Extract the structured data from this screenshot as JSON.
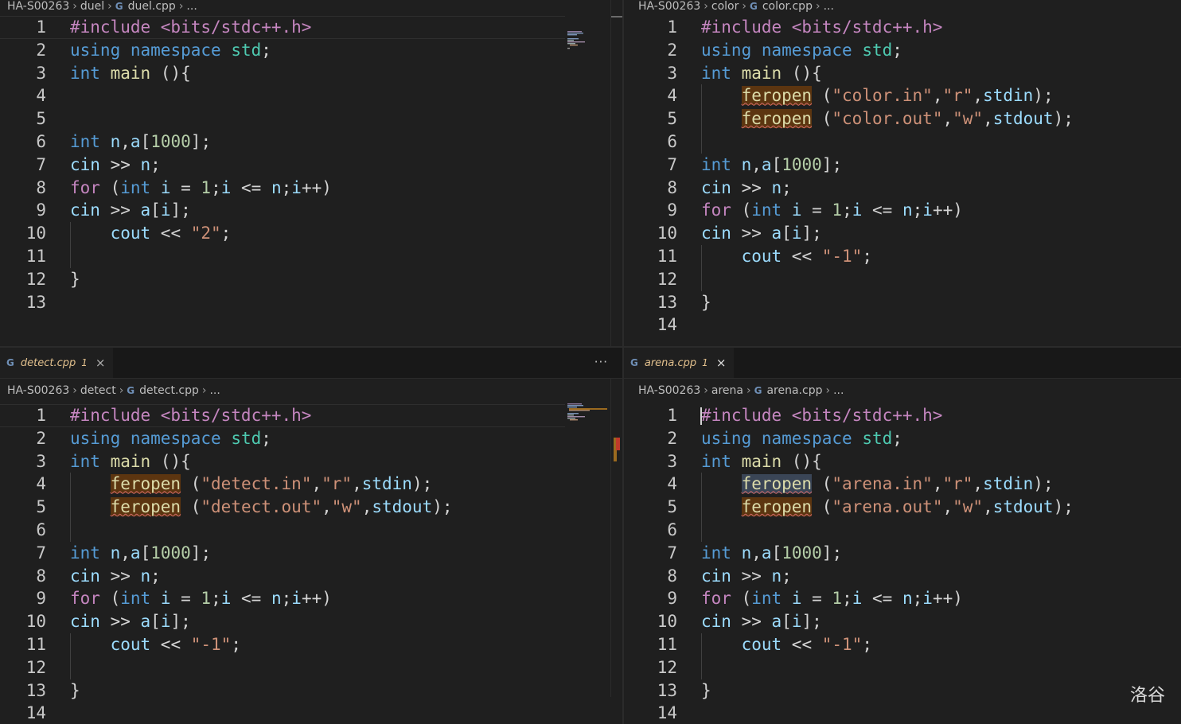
{
  "panes": {
    "tl": {
      "crumbs": {
        "root": "HA-S00263",
        "folder": "duel",
        "file": "duel.cpp",
        "more": "..."
      }
    },
    "tr": {
      "crumbs": {
        "root": "HA-S00263",
        "folder": "color",
        "file": "color.cpp",
        "more": "..."
      }
    },
    "bl": {
      "tab": {
        "icon": "C++",
        "name": "detect.cpp",
        "count": "1",
        "close": "×"
      },
      "more": "···",
      "crumbs": {
        "root": "HA-S00263",
        "folder": "detect",
        "file": "detect.cpp",
        "more": "..."
      }
    },
    "br": {
      "tab": {
        "icon": "C++",
        "name": "arena.cpp",
        "count": "1",
        "close": "×"
      },
      "crumbs": {
        "root": "HA-S00263",
        "folder": "arena",
        "file": "arena.cpp",
        "more": "..."
      }
    }
  },
  "code": {
    "include": "#include <bits/stdc++.h>",
    "using": "using",
    "namespace": "namespace",
    "std": "std",
    "int": "int",
    "main": "main",
    "for": "for",
    "cin": "cin",
    "cout": "cout",
    "feropen": "feropen",
    "duel_out": "\"2\"",
    "other_out": "\"-1\"",
    "color_in": "\"color.in\"",
    "color_out": "\"color.out\"",
    "detect_in": "\"detect.in\"",
    "detect_out": "\"detect.out\"",
    "arena_in": "\"arena.in\"",
    "arena_out": "\"arena.out\"",
    "mode_r": "\"r\"",
    "mode_w": "\"w\"",
    "stdin": "stdin",
    "stdout": "stdout",
    "n1000": "1000",
    "one": "1"
  },
  "watermark": "洛谷"
}
